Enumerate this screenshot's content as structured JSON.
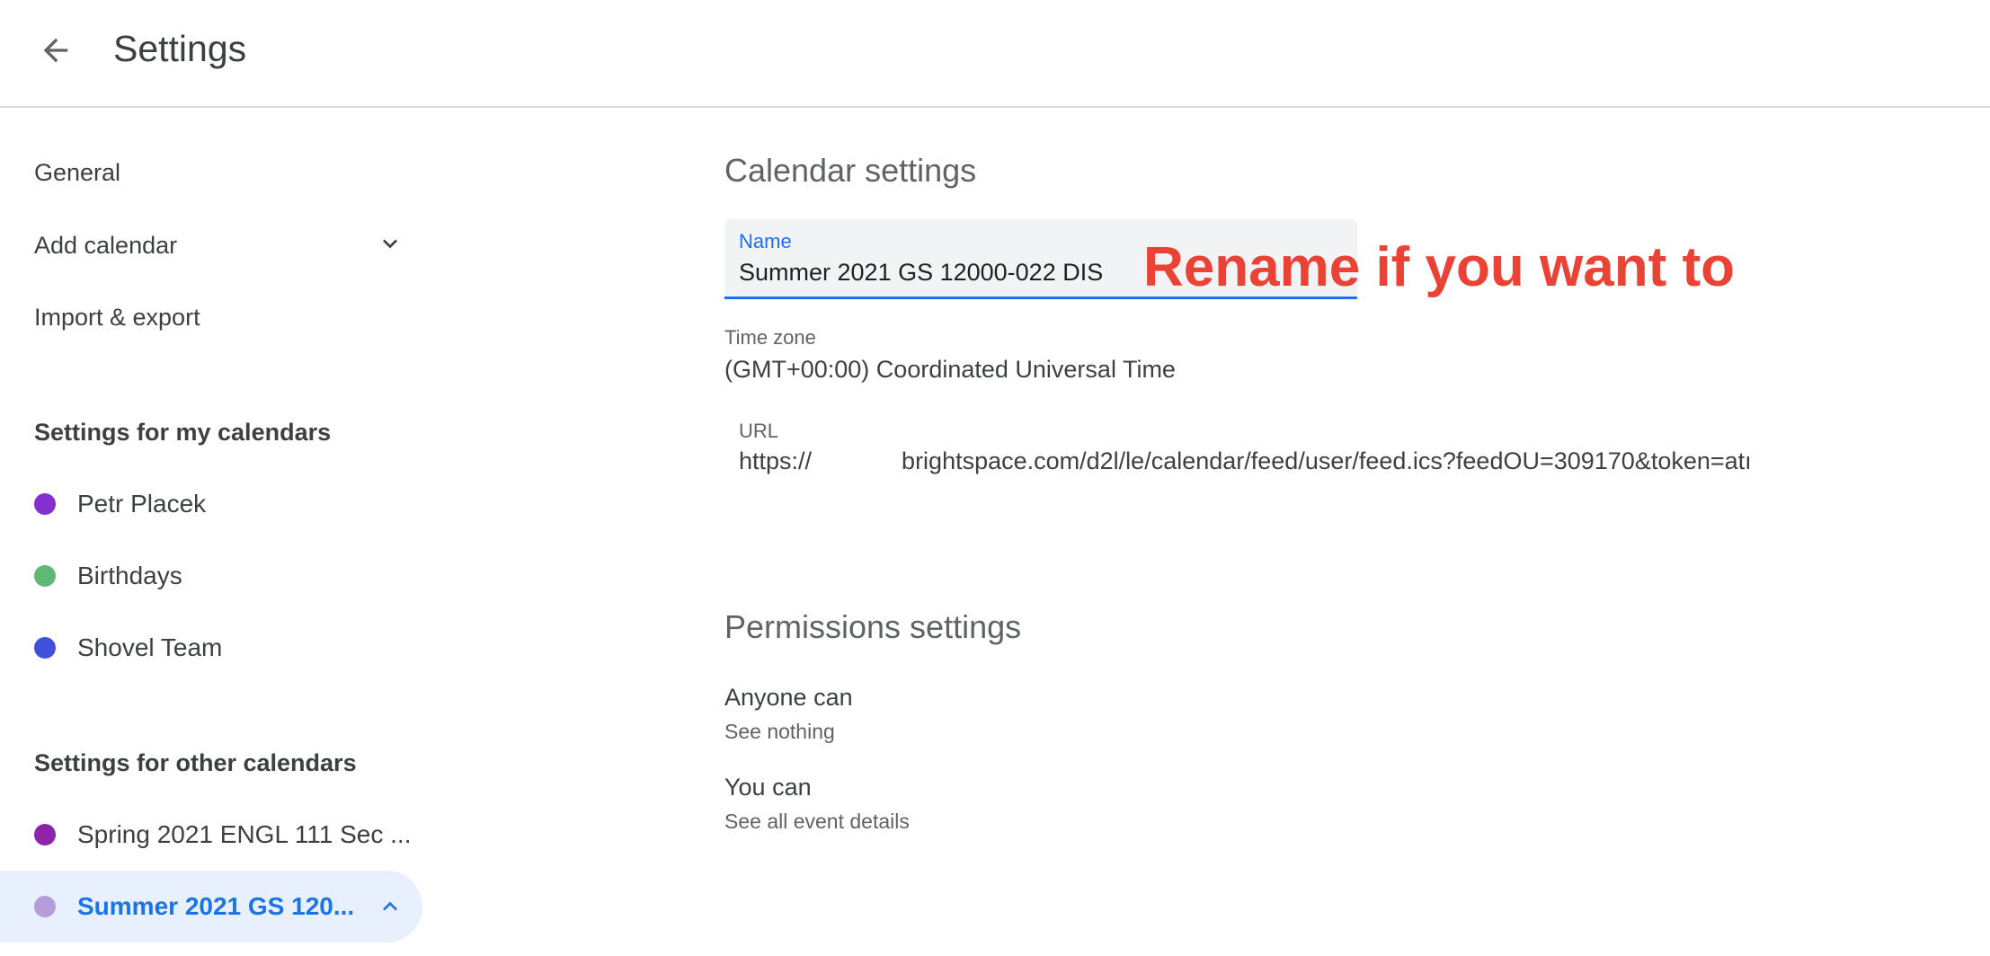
{
  "header": {
    "title": "Settings"
  },
  "sidebar": {
    "nav": [
      {
        "label": "General"
      },
      {
        "label": "Add calendar"
      },
      {
        "label": "Import & export"
      }
    ],
    "my_calendars_heading": "Settings for my calendars",
    "my_calendars": [
      {
        "label": "Petr Placek",
        "color": "#8430ce"
      },
      {
        "label": "Birthdays",
        "color": "#5fb878"
      },
      {
        "label": "Shovel Team",
        "color": "#3f51d8"
      }
    ],
    "other_calendars_heading": "Settings for other calendars",
    "other_calendars": [
      {
        "label": "Spring 2021 ENGL 111 Sec ...",
        "color": "#8e24aa"
      },
      {
        "label": "Summer 2021 GS 120...",
        "color": "#b39ddb",
        "active": true
      }
    ]
  },
  "calendar_settings": {
    "heading": "Calendar settings",
    "name_label": "Name",
    "name_value": "Summer 2021 GS 12000-022 DIS",
    "annotation": "Rename if you want to",
    "timezone_label": "Time zone",
    "timezone_value": "(GMT+00:00) Coordinated Universal Time",
    "url_label": "URL",
    "url_prefix": "https://",
    "url_rest": "brightspace.com/d2l/le/calendar/feed/user/feed.ics?feedOU=309170&token=atı"
  },
  "permissions": {
    "heading": "Permissions settings",
    "anyone_title": "Anyone can",
    "anyone_value": "See nothing",
    "you_title": "You can",
    "you_value": "See all event details"
  },
  "colors": {
    "accent": "#1a73e8",
    "annotation": "#ea4335",
    "active_bg": "#e8f0fe"
  }
}
